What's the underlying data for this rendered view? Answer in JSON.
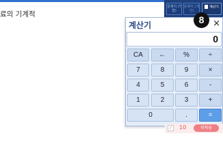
{
  "document": {
    "text": "료의 기계적"
  },
  "toolbar": {
    "btn1": "문제지 (T형)",
    "btn2": "문제지 (개인)",
    "calc_btn": "계산기"
  },
  "badge": "8",
  "calculator": {
    "title": "계산기",
    "close": "×",
    "display": "0",
    "keys": [
      "CA",
      "←",
      "%",
      "÷",
      "7",
      "8",
      "9",
      "×",
      "4",
      "5",
      "6",
      "-",
      "1",
      "2",
      "3",
      "+",
      "0",
      ".",
      "="
    ]
  },
  "row": {
    "checkbox": "✓",
    "number": "10",
    "status": "미작성"
  },
  "colors": {
    "accent": "#1e3f7a",
    "equals": "#5d9ee8",
    "status": "#ee7f84"
  }
}
